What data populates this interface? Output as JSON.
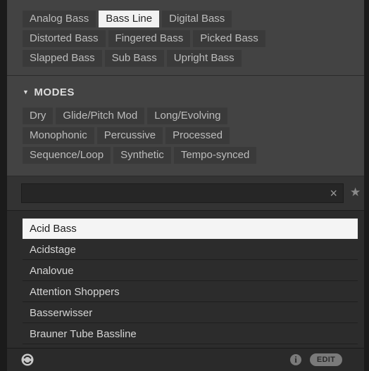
{
  "types": {
    "rows": [
      [
        "Analog Bass",
        "Bass Line",
        "Digital Bass"
      ],
      [
        "Distorted Bass",
        "Fingered Bass",
        "Picked Bass"
      ],
      [
        "Slapped Bass",
        "Sub Bass",
        "Upright Bass"
      ]
    ],
    "selected": "Bass Line"
  },
  "modes": {
    "header": "MODES",
    "rows": [
      [
        "Dry",
        "Glide/Pitch Mod",
        "Long/Evolving"
      ],
      [
        "Monophonic",
        "Percussive",
        "Processed"
      ],
      [
        "Sequence/Loop",
        "Synthetic",
        "Tempo-synced"
      ]
    ]
  },
  "search": {
    "value": "",
    "placeholder": "",
    "clear_icon": "×",
    "favorite_icon": "★"
  },
  "results": {
    "items": [
      "Acid Bass",
      "Acidstage",
      "Analovue",
      "Attention Shoppers",
      "Basserwisser",
      "Brauner Tube Bassline"
    ],
    "selected_index": 0
  },
  "footer": {
    "info_label": "i",
    "edit_label": "EDIT"
  },
  "colors": {
    "panel": "#434343",
    "tag": "#3a3a3a",
    "tag_selected": "#f2f2f2",
    "list_bg": "#2c2c2c"
  }
}
